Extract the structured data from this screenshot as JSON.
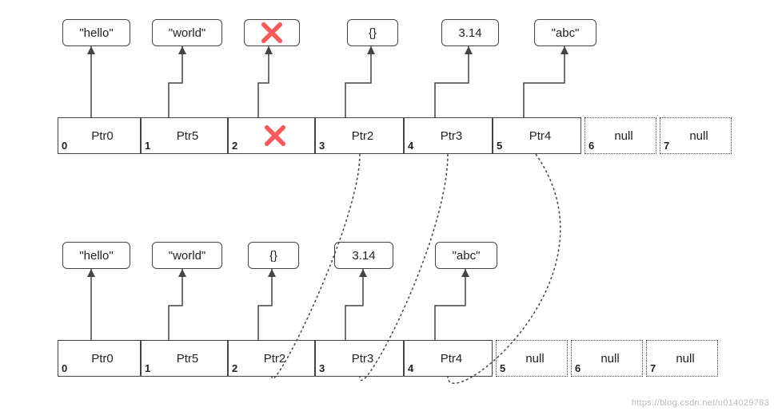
{
  "top": {
    "values": [
      "\"hello\"",
      "\"world\"",
      "X",
      "{}",
      "3.14",
      "\"abc\""
    ],
    "slots": [
      {
        "idx": "0",
        "label": "Ptr0",
        "style": "solid"
      },
      {
        "idx": "1",
        "label": "Ptr5",
        "style": "solid"
      },
      {
        "idx": "2",
        "label": "X",
        "style": "solid"
      },
      {
        "idx": "3",
        "label": "Ptr2",
        "style": "solid"
      },
      {
        "idx": "4",
        "label": "Ptr3",
        "style": "solid"
      },
      {
        "idx": "5",
        "label": "Ptr4",
        "style": "solid"
      },
      {
        "idx": "6",
        "label": "null",
        "style": "dotted"
      },
      {
        "idx": "7",
        "label": "null",
        "style": "dotted"
      }
    ]
  },
  "bottom": {
    "values": [
      "\"hello\"",
      "\"world\"",
      "{}",
      "3.14",
      "\"abc\""
    ],
    "slots": [
      {
        "idx": "0",
        "label": "Ptr0",
        "style": "solid"
      },
      {
        "idx": "1",
        "label": "Ptr5",
        "style": "solid"
      },
      {
        "idx": "2",
        "label": "Ptr2",
        "style": "solid"
      },
      {
        "idx": "3",
        "label": "Ptr3",
        "style": "solid"
      },
      {
        "idx": "4",
        "label": "Ptr4",
        "style": "solid"
      },
      {
        "idx": "5",
        "label": "null",
        "style": "dotted"
      },
      {
        "idx": "6",
        "label": "null",
        "style": "dotted"
      },
      {
        "idx": "7",
        "label": "null",
        "style": "dotted"
      }
    ]
  },
  "watermark": "https://blog.csdn.net/u014029783"
}
